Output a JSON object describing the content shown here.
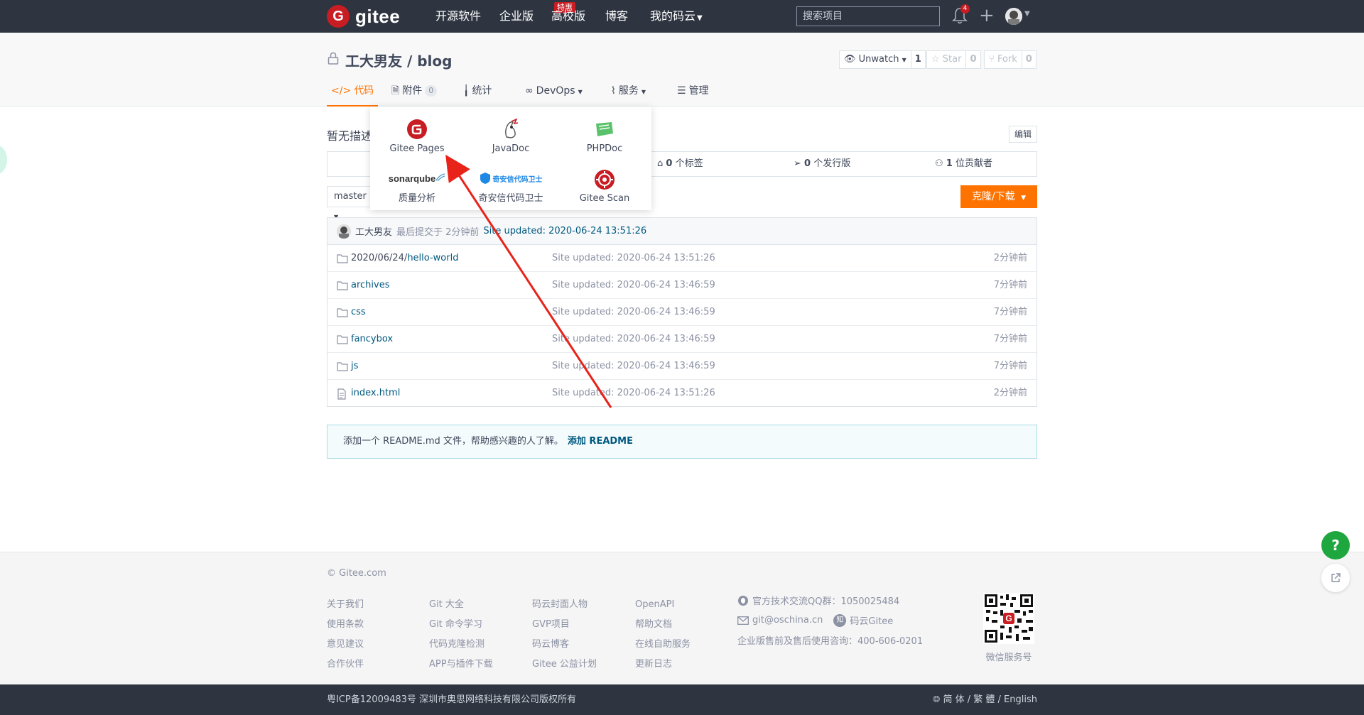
{
  "navbar": {
    "logo_text": "gitee",
    "items": [
      "开源软件",
      "企业版",
      "高校版",
      "博客",
      "我的码云"
    ],
    "enterprise_badge": "特惠",
    "search_placeholder": "搜索项目",
    "notification_count": "4"
  },
  "repo": {
    "owner": "工大男友",
    "name": "blog",
    "title": "工大男友 / blog",
    "watch_label": "Unwatch",
    "watch_count": "1",
    "star_label": "Star",
    "star_count": "0",
    "fork_label": "Fork",
    "fork_count": "0"
  },
  "tabs": [
    {
      "label": "代码",
      "icon": "code-icon",
      "active": true
    },
    {
      "label": "附件",
      "icon": "attachment-icon",
      "count": "0"
    },
    {
      "label": "统计",
      "icon": "stats-icon"
    },
    {
      "label": "DevOps",
      "icon": "infinity-icon"
    },
    {
      "label": "服务",
      "icon": "pulse-icon"
    },
    {
      "label": "管理",
      "icon": "manage-icon"
    }
  ],
  "service_menu": {
    "items": [
      {
        "label": "Gitee Pages",
        "icon": "gitee-pages-icon"
      },
      {
        "label": "JavaDoc",
        "icon": "javadoc-icon"
      },
      {
        "label": "PHPDoc",
        "icon": "phpdoc-icon"
      },
      {
        "label": "质量分析",
        "icon": "sonarqube-logo",
        "logo_text": "sonarqube"
      },
      {
        "label": "奇安信代码卫士",
        "icon": "qianxin-logo",
        "logo_text": "奇安信代码卫士"
      },
      {
        "label": "Gitee Scan",
        "icon": "gitee-scan-icon"
      }
    ]
  },
  "content": {
    "description": "暂无描述",
    "edit_label": "编辑",
    "stats": {
      "tags_count": "0",
      "tags_label": "个标签",
      "releases_count": "0",
      "releases_label": "个发行版",
      "contributors_count": "1",
      "contributors_label": "位贡献者"
    },
    "branch": "master",
    "clone_label": "克隆/下载"
  },
  "last_commit": {
    "author": "工大男友",
    "text": "最后提交于 2分钟前",
    "message": "Site updated: 2020-06-24 13:51:26"
  },
  "files": [
    {
      "type": "folder",
      "prefix": "2020/06/24/",
      "name": "hello-world",
      "message": "Site updated: 2020-06-24 13:51:26",
      "time": "2分钟前"
    },
    {
      "type": "folder",
      "prefix": "",
      "name": "archives",
      "message": "Site updated: 2020-06-24 13:46:59",
      "time": "7分钟前"
    },
    {
      "type": "folder",
      "prefix": "",
      "name": "css",
      "message": "Site updated: 2020-06-24 13:46:59",
      "time": "7分钟前"
    },
    {
      "type": "folder",
      "prefix": "",
      "name": "fancybox",
      "message": "Site updated: 2020-06-24 13:46:59",
      "time": "7分钟前"
    },
    {
      "type": "folder",
      "prefix": "",
      "name": "js",
      "message": "Site updated: 2020-06-24 13:46:59",
      "time": "7分钟前"
    },
    {
      "type": "file",
      "prefix": "",
      "name": "index.html",
      "message": "Site updated: 2020-06-24 13:51:26",
      "time": "2分钟前"
    }
  ],
  "readme_tip": {
    "text": "添加一个 README.md 文件，帮助感兴趣的人了解。",
    "link": "添加 README"
  },
  "footer": {
    "copyright": "© Gitee.com",
    "columns": [
      [
        "关于我们",
        "使用条款",
        "意见建议",
        "合作伙伴"
      ],
      [
        "Git 大全",
        "Git 命令学习",
        "代码克隆检测",
        "APP与插件下载"
      ],
      [
        "码云封面人物",
        "GVP项目",
        "码云博客",
        "Gitee 公益计划"
      ],
      [
        "OpenAPI",
        "帮助文档",
        "在线自助服务",
        "更新日志"
      ]
    ],
    "qq_group": "官方技术交流QQ群：1050025484",
    "email": "git@oschina.cn",
    "zhihu": "码云Gitee",
    "consult": "企业版售前及售后使用咨询：400-606-0201",
    "qr_label": "微信服务号",
    "icp": "粤ICP备12009483号 深圳市奥思网络科技有限公司版权所有",
    "lang": "简 体 / 繁 體 / English"
  },
  "help_label": "?",
  "colors": {
    "navbar": "#2e3440",
    "brand_red": "#c71d23",
    "accent_orange": "#fe7300",
    "link": "#005980",
    "help_green": "#1ea63f",
    "annotation_arrow": "#e8231a"
  }
}
